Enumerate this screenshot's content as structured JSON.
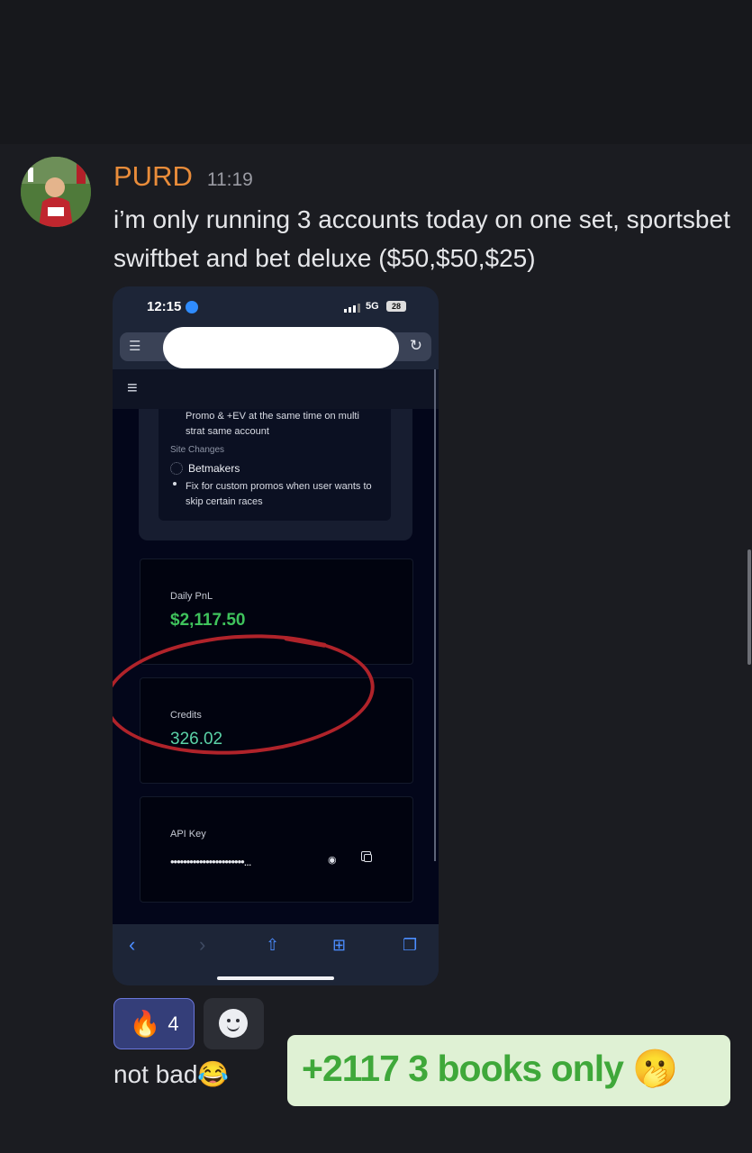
{
  "message": {
    "username": "PURD",
    "timestamp": "11:19",
    "text": "i’m only running 3 accounts today on one set, sportsbet swiftbet and bet deluxe ($50,$50,$25)"
  },
  "phone": {
    "status": {
      "time": "12:15",
      "network": "5G",
      "battery": "28"
    },
    "site": {
      "promo_text": "Promo & +EV at the same time on multi strat same account",
      "site_changes_label": "Site Changes",
      "betmakers_label": "Betmakers",
      "fix_text": "Fix for custom promos when user wants to skip certain races",
      "daily_pnl": {
        "label": "Daily PnL",
        "value": "$2,117.50",
        "color": "#3fc35c"
      },
      "credits": {
        "label": "Credits",
        "value": "326.02",
        "color": "#5bd3a8"
      },
      "api_key": {
        "label": "API Key",
        "value": "•••••••••••••••••••••••..."
      }
    },
    "toolbar_icons": [
      "back-icon",
      "forward-icon",
      "share-icon",
      "bookmarks-icon",
      "tabs-icon"
    ]
  },
  "reactions": [
    {
      "emoji": "🔥",
      "count": "4"
    }
  ],
  "followup_text": "not bad😂",
  "caption": "+2117 3 books only 🫢",
  "colors": {
    "username": "#e98c3a",
    "caption_green": "#3fa83a",
    "annotation_red": "#b0232a"
  }
}
